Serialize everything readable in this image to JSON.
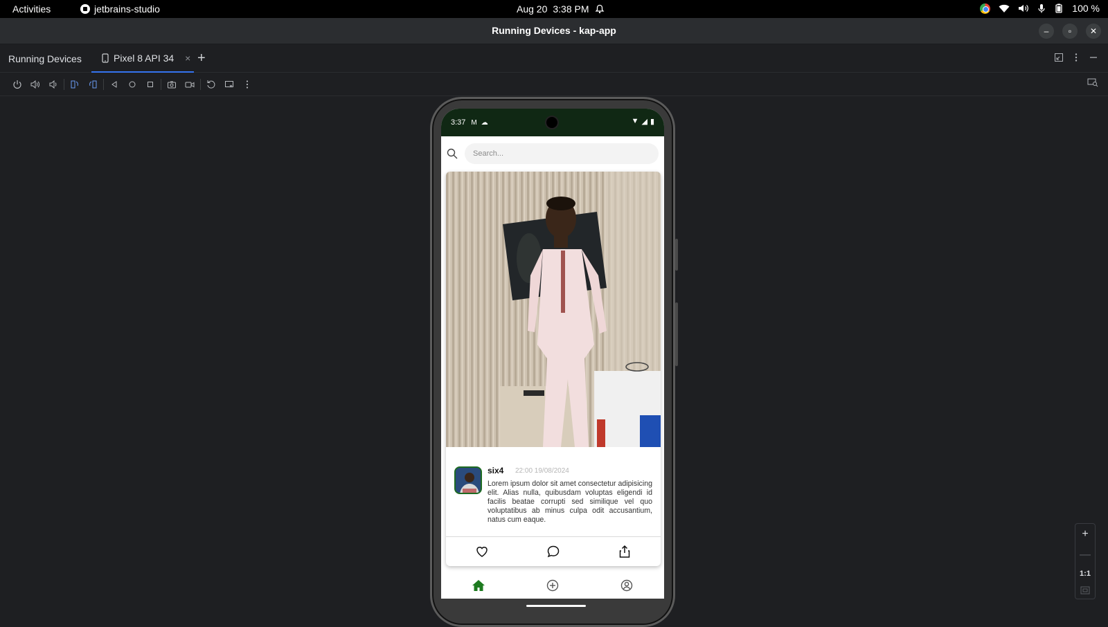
{
  "system_bar": {
    "activities": "Activities",
    "app_name": "jetbrains-studio",
    "date": "Aug 20",
    "time": "3:38 PM",
    "battery": "100 %"
  },
  "window": {
    "title": "Running Devices - kap-app"
  },
  "tool_window": {
    "title": "Running Devices",
    "tab_label": "Pixel 8 API 34",
    "close_glyph": "×",
    "add_glyph": "+"
  },
  "toolbar": {
    "buttons": [
      "power-icon",
      "volume-up-icon",
      "volume-down-icon",
      "rotate-left-icon",
      "rotate-right-icon",
      "back-icon",
      "home-icon",
      "overview-icon",
      "screenshot-icon",
      "screen-record-icon",
      "reset-icon",
      "snapshot-icon",
      "more-icon"
    ]
  },
  "zoom": {
    "plus": "+",
    "minus": "—",
    "ratio": "1:1"
  },
  "device": {
    "status_time": "3:37",
    "search_placeholder": "Search...",
    "post": {
      "username": "six4",
      "timestamp": "22:00 19/08/2024",
      "body": "Lorem ipsum dolor sit amet consectetur adipisicing elit. Alias nulla, quibusdam voluptas eligendi id facilis beatae corrupti sed similique vel quo voluptatibus ab minus culpa odit accusantium, natus cum eaque."
    },
    "accent_color": "#1d7a1f",
    "status_bar_color": "#102814"
  }
}
